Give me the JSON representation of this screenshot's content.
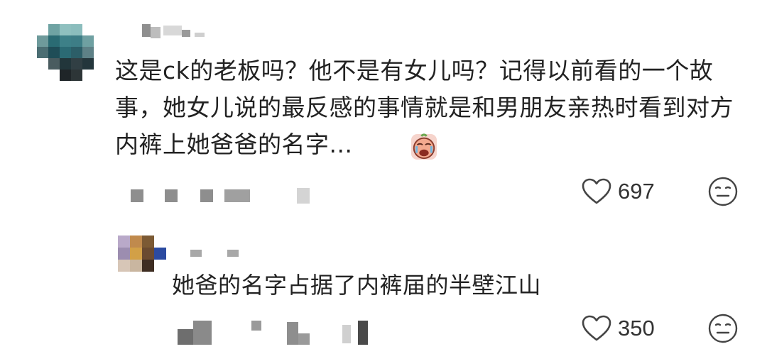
{
  "comments": [
    {
      "text": "这是ck的老板吗？他不是有女儿吗？记得以前看的一个故事，她女儿说的最反感的事情就是和男朋友亲热时看到对方内裤上她爸爸的名字...",
      "emoji": "crying-face-emoji",
      "likes": "697"
    },
    {
      "text": "她爸的名字占据了内裤届的半壁江山",
      "likes": "350"
    }
  ],
  "icons": {
    "like": "heart-outline-icon",
    "react": "expressionless-face-icon"
  },
  "colors": {
    "text": "#222222",
    "muted": "#9a9a9a",
    "icon": "#444444"
  }
}
